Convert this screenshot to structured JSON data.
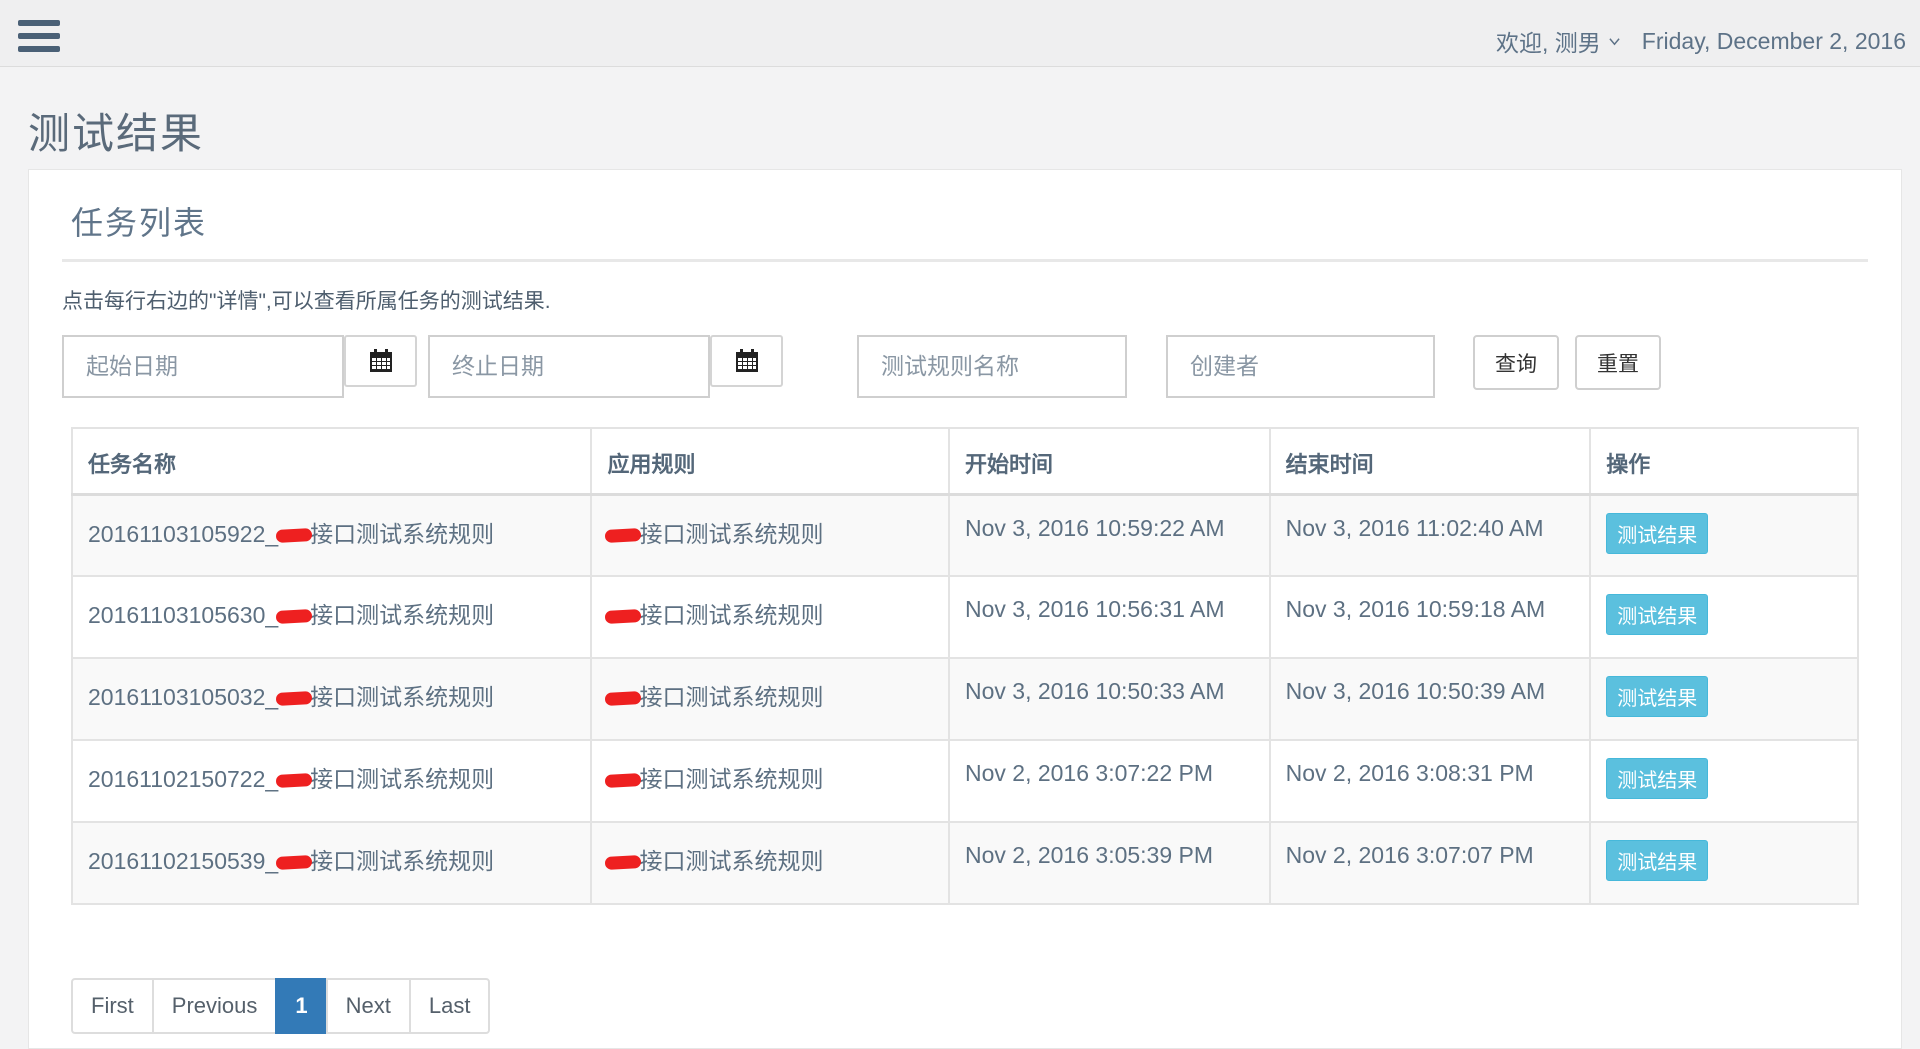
{
  "header": {
    "welcome": "欢迎, 测男",
    "date": "Friday, December 2, 2016"
  },
  "page_title": "测试结果",
  "panel": {
    "title": "任务列表",
    "hint": "点击每行右边的\"详情\",可以查看所属任务的测试结果."
  },
  "filters": {
    "start_placeholder": "起始日期",
    "end_placeholder": "终止日期",
    "rule_placeholder": "测试规则名称",
    "creator_placeholder": "创建者",
    "query_label": "查询",
    "reset_label": "重置"
  },
  "table": {
    "headers": [
      "任务名称",
      "应用规则",
      "开始时间",
      "结束时间",
      "操作"
    ],
    "rows": [
      {
        "name_prefix": "20161103105922_",
        "name_suffix": "接口测试系统规则",
        "rule": "接口测试系统规则",
        "start": "Nov 3, 2016 10:59:22 AM",
        "end": "Nov 3, 2016 11:02:40 AM",
        "action": "测试结果"
      },
      {
        "name_prefix": "20161103105630_",
        "name_suffix": "接口测试系统规则",
        "rule": "接口测试系统规则",
        "start": "Nov 3, 2016 10:56:31 AM",
        "end": "Nov 3, 2016 10:59:18 AM",
        "action": "测试结果"
      },
      {
        "name_prefix": "20161103105032_",
        "name_suffix": "接口测试系统规则",
        "rule": "接口测试系统规则",
        "start": "Nov 3, 2016 10:50:33 AM",
        "end": "Nov 3, 2016 10:50:39 AM",
        "action": "测试结果"
      },
      {
        "name_prefix": "20161102150722_",
        "name_suffix": "接口测试系统规则",
        "rule": "接口测试系统规则",
        "start": "Nov 2, 2016 3:07:22 PM",
        "end": "Nov 2, 2016 3:08:31 PM",
        "action": "测试结果"
      },
      {
        "name_prefix": "20161102150539_",
        "name_suffix": "接口测试系统规则",
        "rule": "接口测试系统规则",
        "start": "Nov 2, 2016 3:05:39 PM",
        "end": "Nov 2, 2016 3:07:07 PM",
        "action": "测试结果"
      }
    ]
  },
  "pagination": {
    "first": "First",
    "previous": "Previous",
    "current": "1",
    "next": "Next",
    "last": "Last"
  },
  "icons": {
    "menu": "hamburger-menu-icon",
    "calendar": "calendar-icon",
    "dropdown": "chevron-down-icon"
  },
  "colors": {
    "action_button": "#5bc0de",
    "pager_active": "#337ab7",
    "redaction": "#ee2020"
  }
}
